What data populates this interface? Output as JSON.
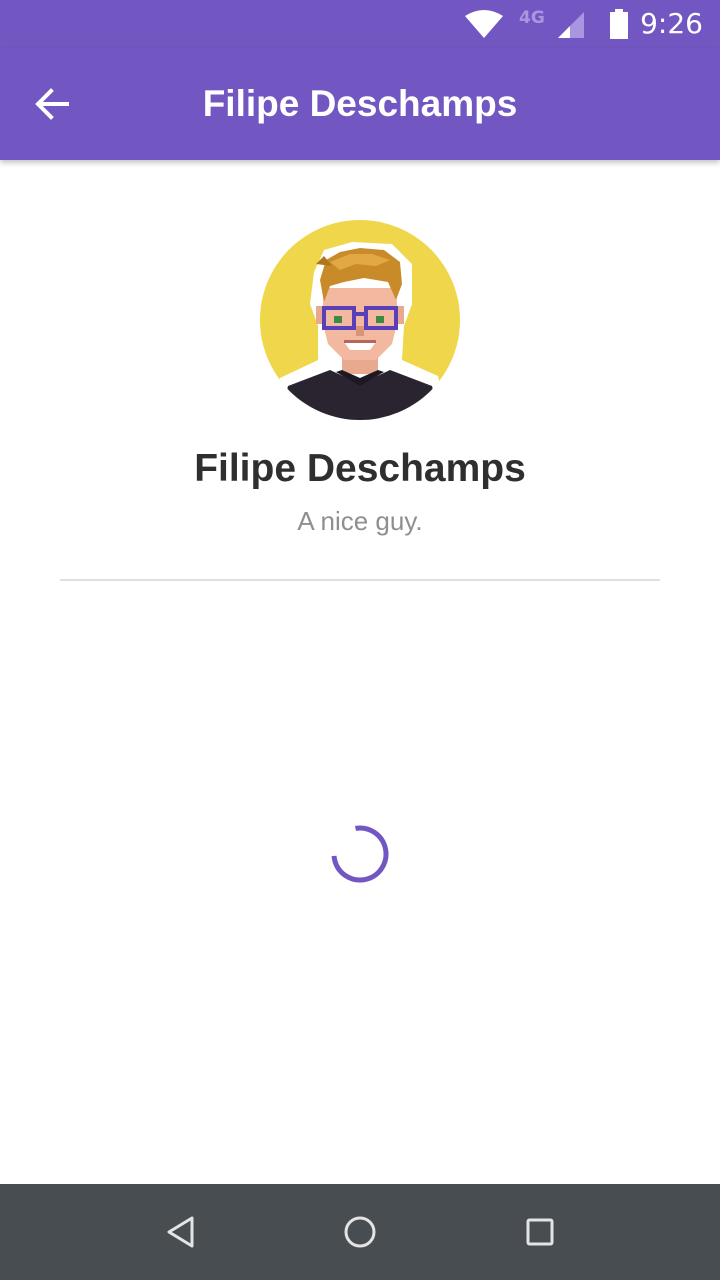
{
  "status_bar": {
    "network_type": "4G",
    "time": "9:26",
    "icons": [
      "wifi-icon",
      "cell-signal-icon",
      "battery-icon"
    ]
  },
  "app_bar": {
    "title": "Filipe Deschamps",
    "back_icon": "arrow-left-icon"
  },
  "profile": {
    "name": "Filipe Deschamps",
    "bio": "A nice guy."
  },
  "loading": {
    "icon": "progress-spinner-icon"
  },
  "nav_bar": {
    "icons": [
      "back-triangle-icon",
      "home-circle-icon",
      "recents-square-icon"
    ]
  },
  "colors": {
    "primary": "#7257c2",
    "avatar_background": "#efd64a",
    "nav_bar": "#484d52",
    "name_text": "#2f2f2f",
    "bio_text": "#8f8f8f"
  }
}
